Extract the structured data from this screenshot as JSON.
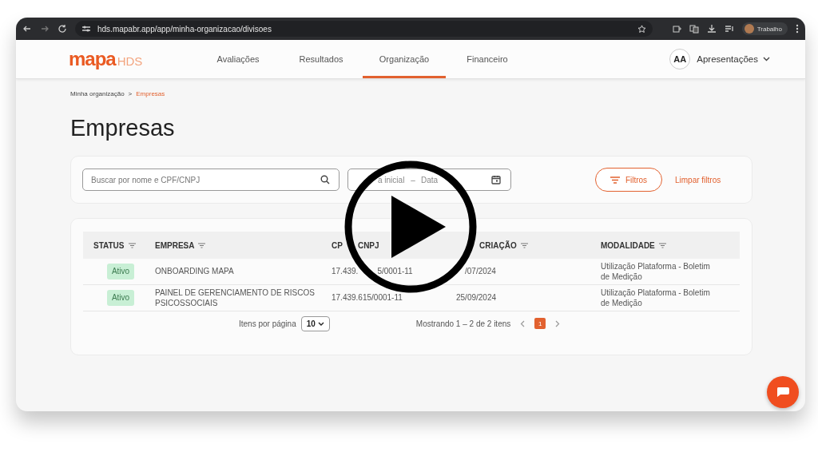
{
  "browser": {
    "url": "hds.mapabr.app/app/minha-organizacao/divisoes",
    "profile": "Trabalho"
  },
  "header": {
    "logo_main": "mapa",
    "logo_sub": "HDS",
    "nav": [
      {
        "label": "Avaliações",
        "selected": false
      },
      {
        "label": "Resultados",
        "selected": false
      },
      {
        "label": "Organização",
        "selected": true
      },
      {
        "label": "Financeiro",
        "selected": false
      }
    ],
    "avatar": "AA",
    "account": "Apresentações"
  },
  "breadcrumb": [
    {
      "label": "Minha organização",
      "current": false
    },
    {
      "label": "Empresas",
      "current": true
    }
  ],
  "breadcrumb_separator": ">",
  "title": "Empresas",
  "filters": {
    "search_placeholder": "Buscar por nome e CPF/CNPJ",
    "date_start": "a inicial",
    "date_separator": "–",
    "date_end": "Data",
    "filter_button": "Filtros",
    "clear": "Limpar filtros"
  },
  "table": {
    "columns": [
      {
        "parts": [
          "STATUS"
        ]
      },
      {
        "parts": [
          "EMPRESA"
        ]
      },
      {
        "parts": [
          "CP",
          "CNPJ"
        ]
      },
      {
        "parts": [
          "CRIAÇÃO"
        ]
      },
      {
        "parts": [
          "MODALIDADE"
        ]
      }
    ],
    "rows": [
      {
        "status": "Ativo",
        "empresa": "ONBOARDING MAPA",
        "cnpj": [
          "17.439.",
          "5/0001-11"
        ],
        "date": "/07/2024",
        "modalidade": "Utilização Plataforma - Boletim de Medição"
      },
      {
        "status": "Ativo",
        "empresa": "PAINEL DE GERENCIAMENTO DE RISCOS PSICOSSOCIAIS",
        "cnpj": [
          "17.439.615/0001-11"
        ],
        "date": "25/09/2024",
        "modalidade": "Utilização Plataforma - Boletim de Medição"
      }
    ]
  },
  "pagination": {
    "per_page_label": "Itens por página",
    "per_page": "10",
    "summary": "Mostrando 1 – 2 de 2 itens",
    "pages": [
      {
        "label": "1",
        "selected": true
      }
    ]
  }
}
